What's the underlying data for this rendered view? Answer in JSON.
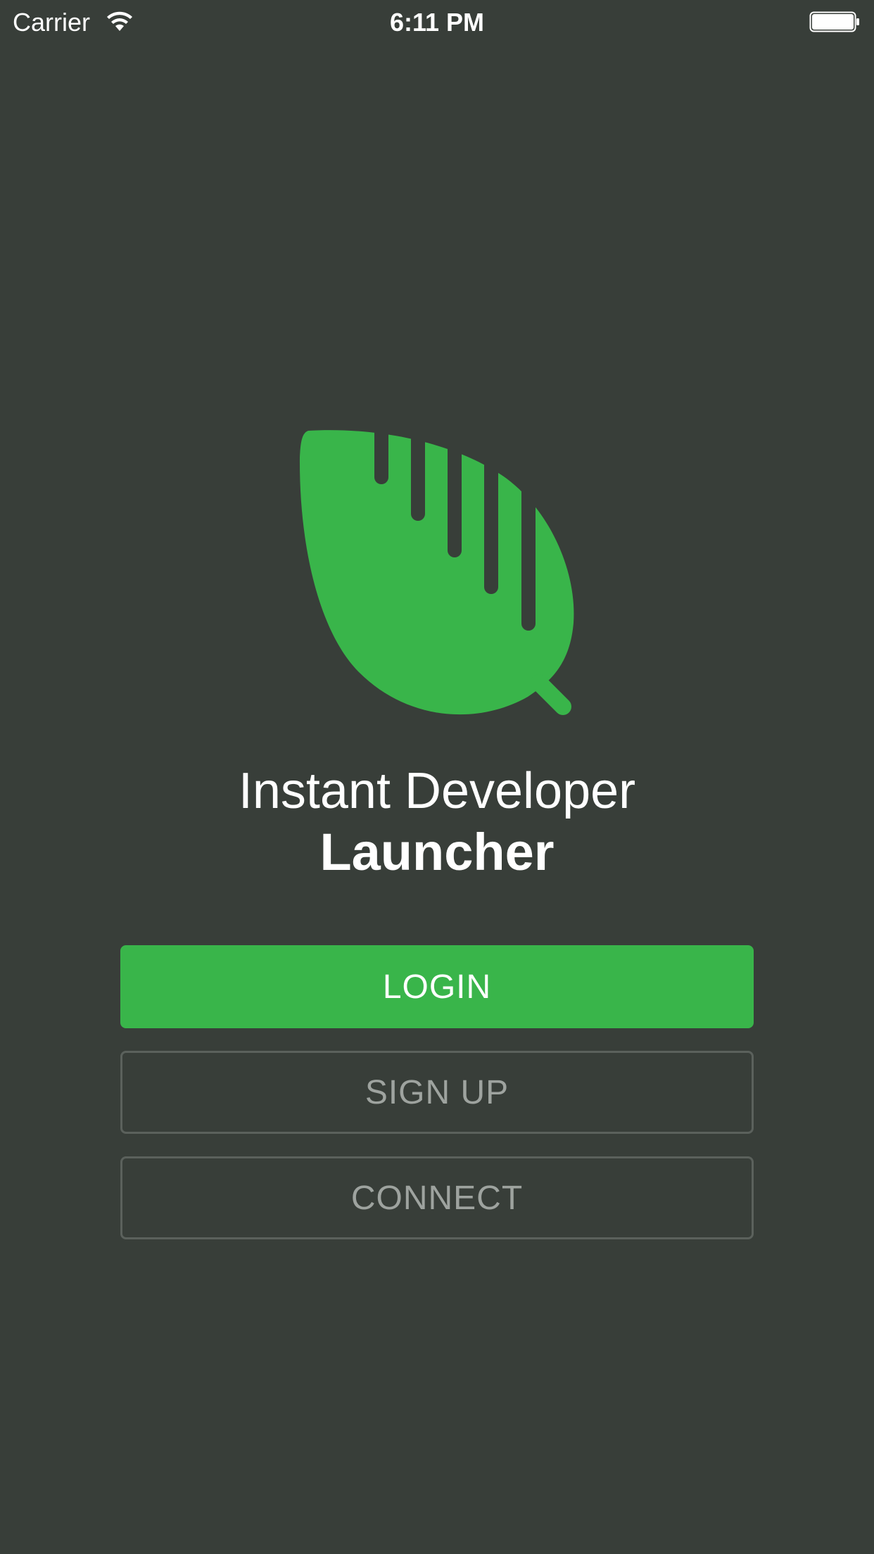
{
  "status_bar": {
    "carrier": "Carrier",
    "time": "6:11 PM",
    "wifi_icon": "wifi-icon",
    "battery_icon": "battery-icon"
  },
  "app": {
    "logo_icon": "leaf-logo-icon",
    "title_line1": "Instant Developer",
    "title_line2": "Launcher"
  },
  "buttons": {
    "login_label": "LOGIN",
    "signup_label": "SIGN UP",
    "connect_label": "CONNECT"
  },
  "colors": {
    "background": "#383e39",
    "accent": "#39b54a",
    "outline_border": "#5b615c",
    "outline_text": "#9ea39f"
  }
}
